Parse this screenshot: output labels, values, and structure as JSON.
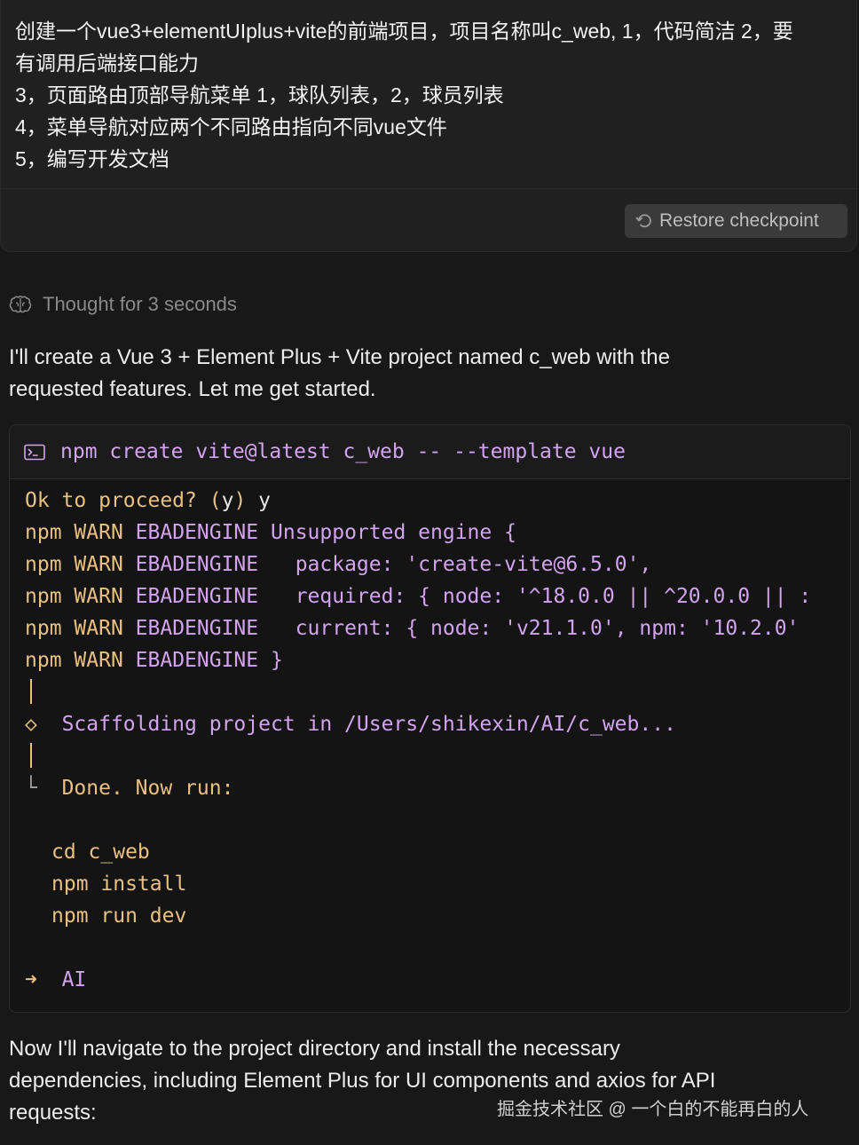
{
  "user_message": {
    "lines": [
      "创建一个vue3+elementUIplus+vite的前端项目，项目名称叫c_web, 1，代码简洁 2，要",
      "有调用后端接口能力",
      "3，页面路由顶部导航菜单 1，球队列表，2，球员列表",
      "4，菜单导航对应两个不同路由指向不同vue文件",
      "5，编写开发文档"
    ],
    "restore_label": "Restore checkpoint"
  },
  "thought": {
    "label": "Thought for 3 seconds",
    "icon": "brain-icon"
  },
  "intro": {
    "lines": [
      "I'll create a Vue 3 + Element Plus + Vite project named c_web with the",
      "requested features. Let me get started."
    ]
  },
  "terminal": {
    "icon": "terminal-icon",
    "command": "npm create vite@latest c_web -- --template vue",
    "output": {
      "proceed_prompt": "Ok to proceed?",
      "proceed_open": "(",
      "proceed_y": "y",
      "proceed_close": ")",
      "proceed_answer": "y",
      "warn_prefix": "npm",
      "warn_word": "WARN",
      "warn_code": "EBADENGINE",
      "warn_lines": [
        "Unsupported engine {",
        "  package: 'create-vite@6.5.0',",
        "  required: { node: '^18.0.0 || ^20.0.0 || :",
        "  current: { node: 'v21.1.0', npm: '10.2.0'",
        "}"
      ],
      "diamond": "◇",
      "scaffold": "Scaffolding project in /Users/shikexin/AI/c_web...",
      "corner": "└",
      "done": "Done. Now run:",
      "next_steps": [
        "cd c_web",
        "npm install",
        "npm run dev"
      ],
      "arrow": "➜",
      "cwd": "AI"
    }
  },
  "followup": {
    "lines": [
      "Now I'll navigate to the project directory and install the necessary",
      "dependencies, including Element Plus for UI components and axios for API",
      "requests:"
    ]
  },
  "watermark": "掘金技术社区 @ 一个白的不能再白的人"
}
